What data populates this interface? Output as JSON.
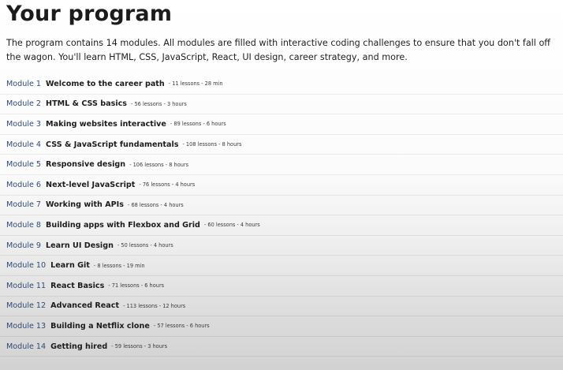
{
  "heading": "Your program",
  "intro": "The program contains 14 modules. All modules are filled with interactive coding challenges to ensure that you don't fall off the wagon. You'll learn HTML, CSS, JavaScript, React, UI design, career strategy, and more.",
  "modules": [
    {
      "number": "Module 1",
      "name": "Welcome to the career path",
      "meta": "- 11 lessons - 28 min"
    },
    {
      "number": "Module 2",
      "name": "HTML & CSS basics",
      "meta": "- 56 lessons - 3 hours"
    },
    {
      "number": "Module 3",
      "name": "Making websites interactive",
      "meta": "- 89 lessons - 6 hours"
    },
    {
      "number": "Module 4",
      "name": "CSS & JavaScript fundamentals",
      "meta": "- 108 lessons - 8 hours"
    },
    {
      "number": "Module 5",
      "name": "Responsive design",
      "meta": "- 106 lessons - 8 hours"
    },
    {
      "number": "Module 6",
      "name": "Next-level JavaScript",
      "meta": "- 76 lessons - 4 hours"
    },
    {
      "number": "Module 7",
      "name": "Working with APIs",
      "meta": "- 68 lessons - 4 hours"
    },
    {
      "number": "Module 8",
      "name": "Building apps with Flexbox and Grid",
      "meta": "- 60 lessons - 4 hours"
    },
    {
      "number": "Module 9",
      "name": "Learn UI Design",
      "meta": "- 50 lessons - 4 hours"
    },
    {
      "number": "Module 10",
      "name": "Learn Git",
      "meta": "- 8 lessons - 19 min"
    },
    {
      "number": "Module 11",
      "name": "React Basics",
      "meta": "- 71 lessons - 6 hours"
    },
    {
      "number": "Module 12",
      "name": "Advanced React",
      "meta": "- 113 lessons - 12 hours"
    },
    {
      "number": "Module 13",
      "name": "Building a Netflix clone",
      "meta": "- 57 lessons - 6 hours"
    },
    {
      "number": "Module 14",
      "name": "Getting hired",
      "meta": "- 59 lessons - 3 hours"
    }
  ]
}
